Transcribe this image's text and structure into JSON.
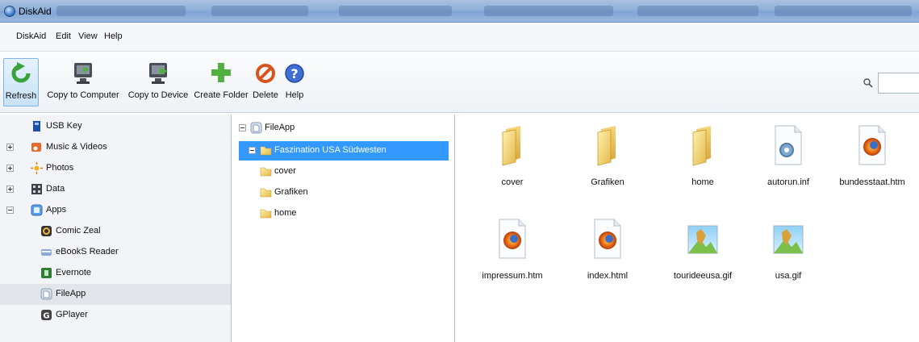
{
  "window": {
    "title": "DiskAid"
  },
  "menu": [
    "DiskAid",
    "Edit",
    "View",
    "Help"
  ],
  "toolbar": {
    "refresh": "Refresh",
    "copy_to_computer": "Copy to Computer",
    "copy_to_device": "Copy to Device",
    "create_folder": "Create Folder",
    "delete": "Delete",
    "help": "Help"
  },
  "search": {
    "value": ""
  },
  "sidebar": {
    "items": [
      {
        "label": "USB Key",
        "icon": "usb-key-icon"
      },
      {
        "label": "Music & Videos",
        "icon": "music-icon"
      },
      {
        "label": "Photos",
        "icon": "photos-icon"
      },
      {
        "label": "Data",
        "icon": "data-icon"
      },
      {
        "label": "Apps",
        "icon": "apps-icon"
      },
      {
        "label": "Comic Zeal",
        "icon": "comic-zeal-icon"
      },
      {
        "label": "eBookS Reader",
        "icon": "ebook-reader-icon"
      },
      {
        "label": "Evernote",
        "icon": "evernote-icon"
      },
      {
        "label": "FileApp",
        "icon": "fileapp-icon"
      },
      {
        "label": "GPlayer",
        "icon": "gplayer-icon"
      }
    ]
  },
  "tree": {
    "root": "FileApp",
    "selected": "Faszination USA Südwesten",
    "children": [
      "cover",
      "Grafiken",
      "home"
    ]
  },
  "files": [
    {
      "name": "cover",
      "type": "folder"
    },
    {
      "name": "Grafiken",
      "type": "folder"
    },
    {
      "name": "home",
      "type": "folder"
    },
    {
      "name": "autorun.inf",
      "type": "settings"
    },
    {
      "name": "bundesstaat.htm",
      "type": "html"
    },
    {
      "name": "impressum.htm",
      "type": "html"
    },
    {
      "name": "index.html",
      "type": "html"
    },
    {
      "name": "tourideeusa.gif",
      "type": "image"
    },
    {
      "name": "usa.gif",
      "type": "image"
    }
  ],
  "colors": {
    "selection": "#3399ff",
    "toolbar_active": "#c8e2f7"
  }
}
